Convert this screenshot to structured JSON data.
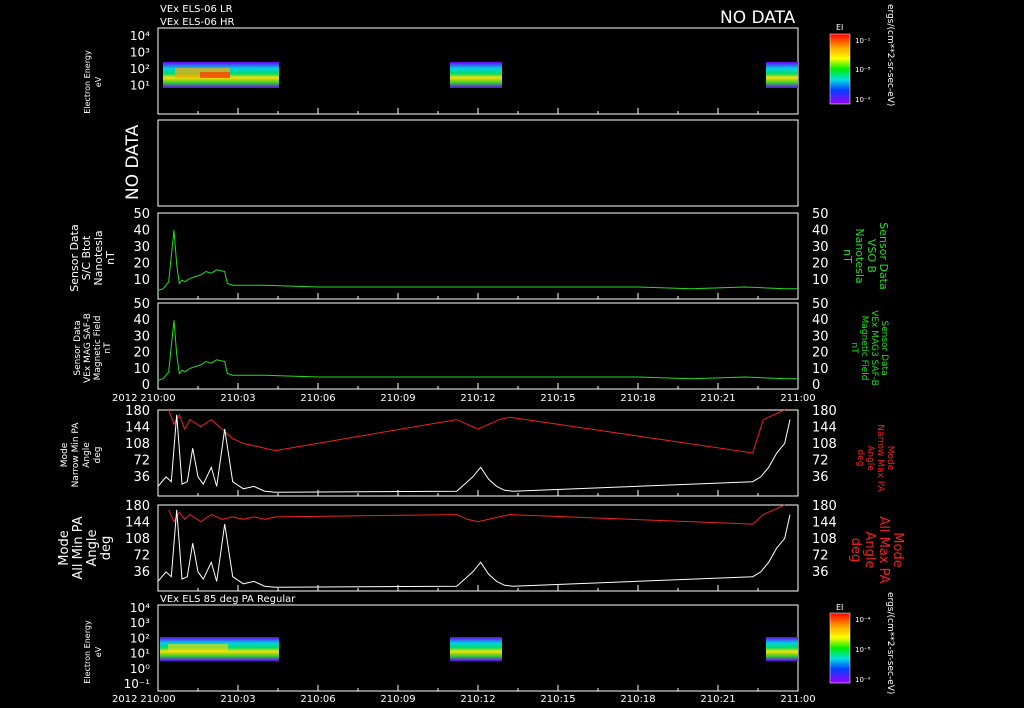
{
  "header": {
    "line1": "VEx ELS-06 LR",
    "line2": "VEx ELS-06 HR",
    "no_data_top": "NO DATA"
  },
  "x_axis": {
    "year": "2012",
    "ticks": [
      "210:00",
      "210:03",
      "210:06",
      "210:09",
      "210:12",
      "210:15",
      "210:18",
      "210:21",
      "211:00"
    ]
  },
  "panels": {
    "els_lr_hr": {
      "ylabel": [
        "Electron Energy",
        "eV"
      ],
      "ticks": [
        "10⁴",
        "10³",
        "10²",
        "10¹"
      ],
      "colorbar": {
        "title": "EI",
        "ticks": [
          "10⁻¹",
          "10⁻⁸",
          "10⁻⁹"
        ],
        "unit": "ergs/(cm**2-sr-sec-eV)"
      }
    },
    "empty": {
      "text": "NO DATA"
    },
    "btot": {
      "ylabel": [
        "Sensor Data",
        "S/C Btot",
        "Nanotesla",
        "nT"
      ],
      "ylabel_right": [
        "Sensor Data",
        "VSO B",
        "Nanotesla",
        "nT"
      ],
      "ticks": [
        "50",
        "40",
        "30",
        "20",
        "10"
      ]
    },
    "mag": {
      "ylabel": [
        "Sensor Data",
        "VEx MAG SAF-B",
        "Magnetic Field",
        "nT"
      ],
      "ylabel_right": [
        "Sensor Data",
        "VEx MAG3 SAF-B",
        "Magnetic Field",
        "nT"
      ],
      "ticks": [
        "50",
        "40",
        "30",
        "20",
        "10",
        "0"
      ]
    },
    "narrow_pa": {
      "ylabel": [
        "Mode",
        "Narrow Min PA",
        "Angle",
        "deg"
      ],
      "ylabel_right": [
        "Mode",
        "Narrow Max PA",
        "Angle",
        "deg"
      ],
      "ticks": [
        "180",
        "144",
        "108",
        "72",
        "36"
      ]
    },
    "all_pa": {
      "ylabel": [
        "Mode",
        "All Min PA",
        "Angle",
        "deg"
      ],
      "ylabel_right": [
        "Mode",
        "All Max PA",
        "Angle",
        "deg"
      ],
      "ticks": [
        "180",
        "144",
        "108",
        "72",
        "36"
      ]
    },
    "els85": {
      "title": "VEx ELS 85 deg PA Regular",
      "ylabel": [
        "Electron Energy",
        "eV"
      ],
      "ticks": [
        "10⁴",
        "10³",
        "10²",
        "10¹",
        "10⁰",
        "10⁻¹"
      ],
      "colorbar": {
        "title": "EI",
        "ticks": [
          "10⁻⁴",
          "10⁻⁸",
          "10⁻⁹"
        ],
        "unit": "ergs/(cm**2-sr-sec-eV)"
      }
    }
  },
  "chart_data": [
    {
      "type": "heatmap",
      "title": "VEx ELS-06 LR / VEx ELS-06 HR",
      "ylabel": "Electron Energy eV",
      "yscale": "log",
      "data_intervals_minutes": [
        [
          0,
          45
        ],
        [
          110,
          134
        ],
        [
          230,
          240
        ]
      ]
    },
    {
      "type": "line",
      "ylabel": "Sensor Data S/C Btot Nanotesla nT",
      "ylim": [
        0,
        50
      ],
      "series": [
        {
          "x": [
            0,
            2,
            4,
            5,
            6,
            7,
            8,
            9,
            10,
            12,
            14,
            16,
            18,
            20,
            22,
            25,
            26,
            28,
            30,
            40,
            60,
            80,
            100,
            120,
            140,
            160,
            180,
            200,
            220,
            235,
            240
          ],
          "y": [
            5,
            6,
            10,
            25,
            40,
            20,
            9,
            11,
            10,
            12,
            13,
            14,
            16,
            15,
            17,
            16,
            9,
            8,
            8,
            8,
            7,
            7,
            7,
            7,
            7,
            7,
            7,
            6,
            7,
            6,
            6
          ]
        }
      ]
    },
    {
      "type": "line",
      "ylabel": "Sensor Data VEx MAG SAF-B Magnetic Field nT",
      "ylim": [
        0,
        50
      ],
      "series": [
        {
          "x": [
            0,
            2,
            4,
            5,
            6,
            7,
            8,
            9,
            10,
            12,
            14,
            16,
            18,
            20,
            22,
            25,
            26,
            28,
            30,
            40,
            60,
            80,
            100,
            120,
            140,
            160,
            180,
            200,
            220,
            235,
            240
          ],
          "y": [
            5,
            6,
            10,
            25,
            40,
            20,
            9,
            11,
            10,
            12,
            13,
            14,
            16,
            15,
            17,
            16,
            9,
            8,
            8,
            8,
            7,
            7,
            7,
            7,
            7,
            7,
            7,
            6,
            7,
            6,
            6
          ]
        }
      ]
    },
    {
      "type": "line",
      "ylabel": "Mode Narrow Min PA Angle deg",
      "ylim": [
        0,
        180
      ],
      "series": [
        {
          "name": "Min PA",
          "x": [
            0,
            3,
            5,
            7,
            9,
            11,
            13,
            15,
            17,
            20,
            22,
            25,
            28,
            32,
            36,
            40,
            44,
            112,
            115,
            118,
            121,
            124,
            127,
            130,
            133,
            223,
            226,
            229,
            232,
            235,
            237
          ],
          "y": [
            20,
            40,
            30,
            170,
            25,
            30,
            100,
            40,
            25,
            60,
            20,
            140,
            30,
            15,
            20,
            10,
            8,
            10,
            25,
            40,
            60,
            35,
            20,
            12,
            10,
            30,
            40,
            60,
            90,
            110,
            160
          ]
        },
        {
          "name": "Max PA",
          "x": [
            4,
            6,
            8,
            10,
            12,
            16,
            20,
            24,
            28,
            32,
            36,
            40,
            44,
            112,
            116,
            120,
            124,
            128,
            132,
            223,
            227,
            231,
            235
          ],
          "y": [
            180,
            150,
            170,
            140,
            160,
            145,
            160,
            140,
            120,
            110,
            105,
            100,
            95,
            160,
            150,
            140,
            150,
            160,
            165,
            90,
            160,
            170,
            180
          ]
        }
      ]
    },
    {
      "type": "line",
      "ylabel": "Mode All Min PA Angle deg",
      "ylim": [
        0,
        180
      ],
      "series": [
        {
          "name": "Min PA",
          "x": [
            0,
            3,
            5,
            7,
            9,
            11,
            13,
            15,
            17,
            20,
            22,
            25,
            28,
            32,
            36,
            40,
            44,
            112,
            115,
            118,
            121,
            124,
            127,
            130,
            133,
            223,
            226,
            229,
            232,
            235,
            237
          ],
          "y": [
            20,
            40,
            30,
            170,
            25,
            30,
            100,
            40,
            25,
            60,
            20,
            140,
            30,
            15,
            20,
            10,
            8,
            10,
            25,
            40,
            60,
            35,
            20,
            12,
            10,
            30,
            40,
            60,
            90,
            110,
            160
          ]
        },
        {
          "name": "Max PA",
          "x": [
            4,
            6,
            8,
            10,
            12,
            16,
            20,
            24,
            28,
            32,
            36,
            40,
            44,
            112,
            116,
            120,
            124,
            128,
            132,
            223,
            227,
            231,
            235
          ],
          "y": [
            170,
            145,
            165,
            150,
            160,
            145,
            160,
            150,
            155,
            150,
            155,
            150,
            155,
            160,
            150,
            145,
            150,
            155,
            160,
            140,
            160,
            170,
            180
          ]
        }
      ]
    },
    {
      "type": "heatmap",
      "title": "VEx ELS 85 deg PA Regular",
      "ylabel": "Electron Energy eV",
      "yscale": "log",
      "data_intervals_minutes": [
        [
          0,
          45
        ],
        [
          110,
          134
        ],
        [
          230,
          240
        ]
      ]
    }
  ]
}
